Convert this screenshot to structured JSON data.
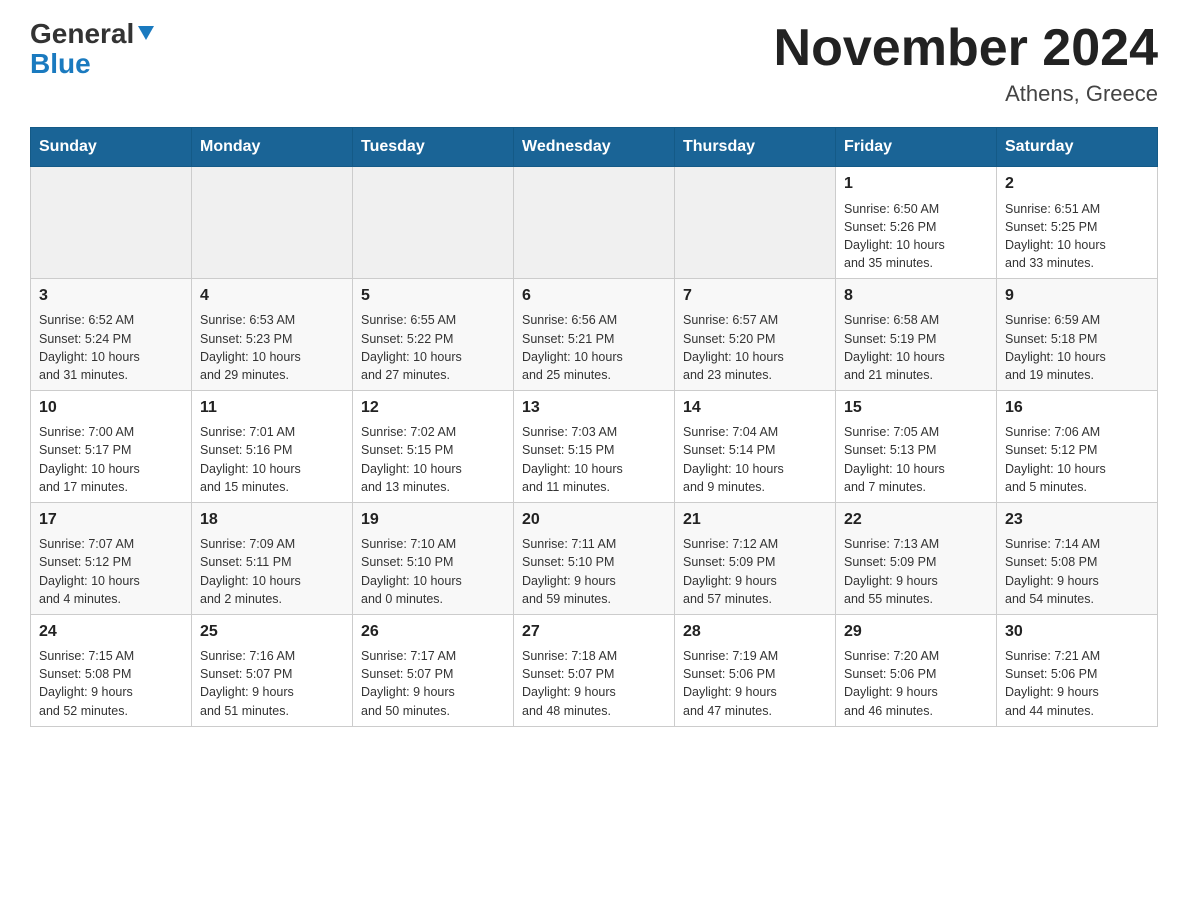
{
  "header": {
    "logo_general": "General",
    "logo_blue": "Blue",
    "month_year": "November 2024",
    "location": "Athens, Greece"
  },
  "days_of_week": [
    "Sunday",
    "Monday",
    "Tuesday",
    "Wednesday",
    "Thursday",
    "Friday",
    "Saturday"
  ],
  "weeks": [
    {
      "days": [
        {
          "number": "",
          "info": ""
        },
        {
          "number": "",
          "info": ""
        },
        {
          "number": "",
          "info": ""
        },
        {
          "number": "",
          "info": ""
        },
        {
          "number": "",
          "info": ""
        },
        {
          "number": "1",
          "info": "Sunrise: 6:50 AM\nSunset: 5:26 PM\nDaylight: 10 hours\nand 35 minutes."
        },
        {
          "number": "2",
          "info": "Sunrise: 6:51 AM\nSunset: 5:25 PM\nDaylight: 10 hours\nand 33 minutes."
        }
      ]
    },
    {
      "days": [
        {
          "number": "3",
          "info": "Sunrise: 6:52 AM\nSunset: 5:24 PM\nDaylight: 10 hours\nand 31 minutes."
        },
        {
          "number": "4",
          "info": "Sunrise: 6:53 AM\nSunset: 5:23 PM\nDaylight: 10 hours\nand 29 minutes."
        },
        {
          "number": "5",
          "info": "Sunrise: 6:55 AM\nSunset: 5:22 PM\nDaylight: 10 hours\nand 27 minutes."
        },
        {
          "number": "6",
          "info": "Sunrise: 6:56 AM\nSunset: 5:21 PM\nDaylight: 10 hours\nand 25 minutes."
        },
        {
          "number": "7",
          "info": "Sunrise: 6:57 AM\nSunset: 5:20 PM\nDaylight: 10 hours\nand 23 minutes."
        },
        {
          "number": "8",
          "info": "Sunrise: 6:58 AM\nSunset: 5:19 PM\nDaylight: 10 hours\nand 21 minutes."
        },
        {
          "number": "9",
          "info": "Sunrise: 6:59 AM\nSunset: 5:18 PM\nDaylight: 10 hours\nand 19 minutes."
        }
      ]
    },
    {
      "days": [
        {
          "number": "10",
          "info": "Sunrise: 7:00 AM\nSunset: 5:17 PM\nDaylight: 10 hours\nand 17 minutes."
        },
        {
          "number": "11",
          "info": "Sunrise: 7:01 AM\nSunset: 5:16 PM\nDaylight: 10 hours\nand 15 minutes."
        },
        {
          "number": "12",
          "info": "Sunrise: 7:02 AM\nSunset: 5:15 PM\nDaylight: 10 hours\nand 13 minutes."
        },
        {
          "number": "13",
          "info": "Sunrise: 7:03 AM\nSunset: 5:15 PM\nDaylight: 10 hours\nand 11 minutes."
        },
        {
          "number": "14",
          "info": "Sunrise: 7:04 AM\nSunset: 5:14 PM\nDaylight: 10 hours\nand 9 minutes."
        },
        {
          "number": "15",
          "info": "Sunrise: 7:05 AM\nSunset: 5:13 PM\nDaylight: 10 hours\nand 7 minutes."
        },
        {
          "number": "16",
          "info": "Sunrise: 7:06 AM\nSunset: 5:12 PM\nDaylight: 10 hours\nand 5 minutes."
        }
      ]
    },
    {
      "days": [
        {
          "number": "17",
          "info": "Sunrise: 7:07 AM\nSunset: 5:12 PM\nDaylight: 10 hours\nand 4 minutes."
        },
        {
          "number": "18",
          "info": "Sunrise: 7:09 AM\nSunset: 5:11 PM\nDaylight: 10 hours\nand 2 minutes."
        },
        {
          "number": "19",
          "info": "Sunrise: 7:10 AM\nSunset: 5:10 PM\nDaylight: 10 hours\nand 0 minutes."
        },
        {
          "number": "20",
          "info": "Sunrise: 7:11 AM\nSunset: 5:10 PM\nDaylight: 9 hours\nand 59 minutes."
        },
        {
          "number": "21",
          "info": "Sunrise: 7:12 AM\nSunset: 5:09 PM\nDaylight: 9 hours\nand 57 minutes."
        },
        {
          "number": "22",
          "info": "Sunrise: 7:13 AM\nSunset: 5:09 PM\nDaylight: 9 hours\nand 55 minutes."
        },
        {
          "number": "23",
          "info": "Sunrise: 7:14 AM\nSunset: 5:08 PM\nDaylight: 9 hours\nand 54 minutes."
        }
      ]
    },
    {
      "days": [
        {
          "number": "24",
          "info": "Sunrise: 7:15 AM\nSunset: 5:08 PM\nDaylight: 9 hours\nand 52 minutes."
        },
        {
          "number": "25",
          "info": "Sunrise: 7:16 AM\nSunset: 5:07 PM\nDaylight: 9 hours\nand 51 minutes."
        },
        {
          "number": "26",
          "info": "Sunrise: 7:17 AM\nSunset: 5:07 PM\nDaylight: 9 hours\nand 50 minutes."
        },
        {
          "number": "27",
          "info": "Sunrise: 7:18 AM\nSunset: 5:07 PM\nDaylight: 9 hours\nand 48 minutes."
        },
        {
          "number": "28",
          "info": "Sunrise: 7:19 AM\nSunset: 5:06 PM\nDaylight: 9 hours\nand 47 minutes."
        },
        {
          "number": "29",
          "info": "Sunrise: 7:20 AM\nSunset: 5:06 PM\nDaylight: 9 hours\nand 46 minutes."
        },
        {
          "number": "30",
          "info": "Sunrise: 7:21 AM\nSunset: 5:06 PM\nDaylight: 9 hours\nand 44 minutes."
        }
      ]
    }
  ]
}
